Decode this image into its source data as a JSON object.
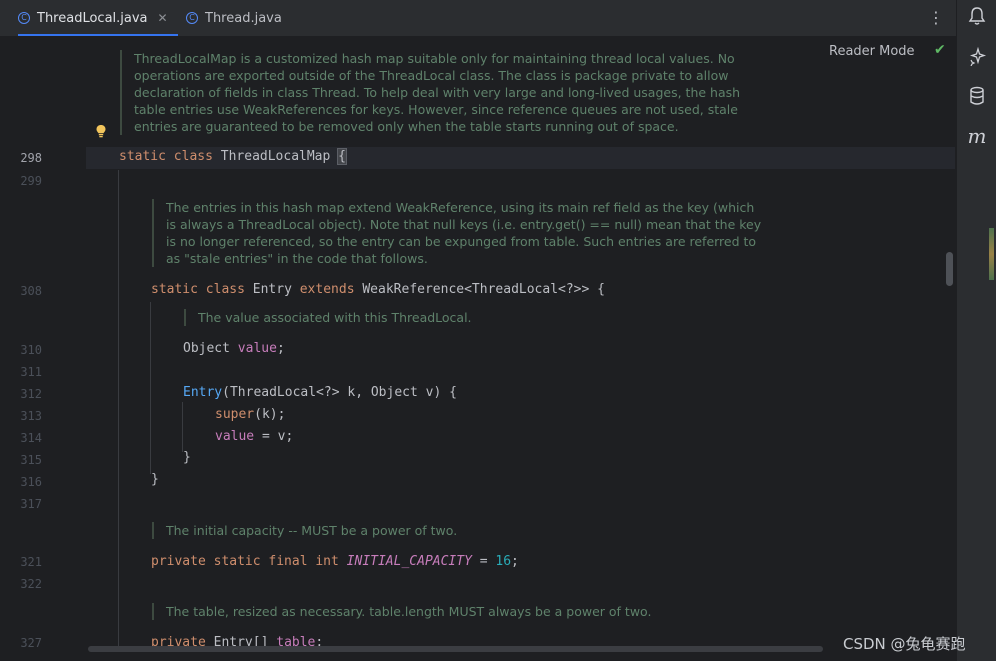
{
  "tabs": [
    {
      "label": "ThreadLocal.java",
      "active": true,
      "icon": "class-icon"
    },
    {
      "label": "Thread.java",
      "active": false,
      "icon": "class-icon"
    }
  ],
  "reader_mode_label": "Reader Mode",
  "docs": {
    "thread_local_map": "ThreadLocalMap is a customized hash map suitable only for maintaining thread local values. No operations are exported outside of the ThreadLocal class. The class is package private to allow declaration of fields in class Thread. To help deal with very large and long-lived usages, the hash table entries use WeakReferences for keys. However, since reference queues are not used, stale entries are guaranteed to be removed only when the table starts running out of space.",
    "entries": "The entries in this hash map extend WeakReference, using its main ref field as the key (which is always a ThreadLocal object). Note that null keys (i.e. entry.get() == null) mean that the key is no longer referenced, so the entry can be expunged from table. Such entries are referred to as \"stale entries\" in the code that follows.",
    "value": "The value associated with this ThreadLocal.",
    "initial_capacity": "The initial capacity -- MUST be a power of two.",
    "table": "The table, resized as necessary. table.length MUST always be a power of two."
  },
  "line_numbers": {
    "l298": "298",
    "l299": "299",
    "l308": "308",
    "l310": "310",
    "l311": "311",
    "l312": "312",
    "l313": "313",
    "l314": "314",
    "l315": "315",
    "l316": "316",
    "l317": "317",
    "l321": "321",
    "l322": "322",
    "l327": "327"
  },
  "code": {
    "l298": {
      "kw1": "static",
      "kw2": "class",
      "name": "ThreadLocalMap",
      "brace": "{"
    },
    "l308": {
      "kw1": "static",
      "kw2": "class",
      "name": "Entry",
      "kw3": "extends",
      "rest": "WeakReference<ThreadLocal<?>> {"
    },
    "l310": {
      "type": "Object",
      "field": "value",
      "end": ";"
    },
    "l312": {
      "fn": "Entry",
      "rest": "(ThreadLocal<?> k, Object v) {"
    },
    "l313": {
      "kw": "super",
      "rest": "(k);"
    },
    "l314": {
      "field": "value",
      "rest": " = v;"
    },
    "l315": {
      "text": "}"
    },
    "l316": {
      "text": "}"
    },
    "l321": {
      "kw": "private static final int",
      "konst": "INITIAL_CAPACITY",
      "mid": " = ",
      "num": "16",
      "end": ";"
    },
    "l327": {
      "kw": "private",
      "type": "Entry[]",
      "field": "table",
      "end": ";"
    }
  },
  "watermark": "CSDN @兔龟赛跑",
  "colors": {
    "accent": "#3574f0",
    "keyword": "#cf8e6d",
    "field": "#c77dbb",
    "function": "#56a8f5",
    "number": "#2aacb8",
    "doc": "#5f826b"
  }
}
